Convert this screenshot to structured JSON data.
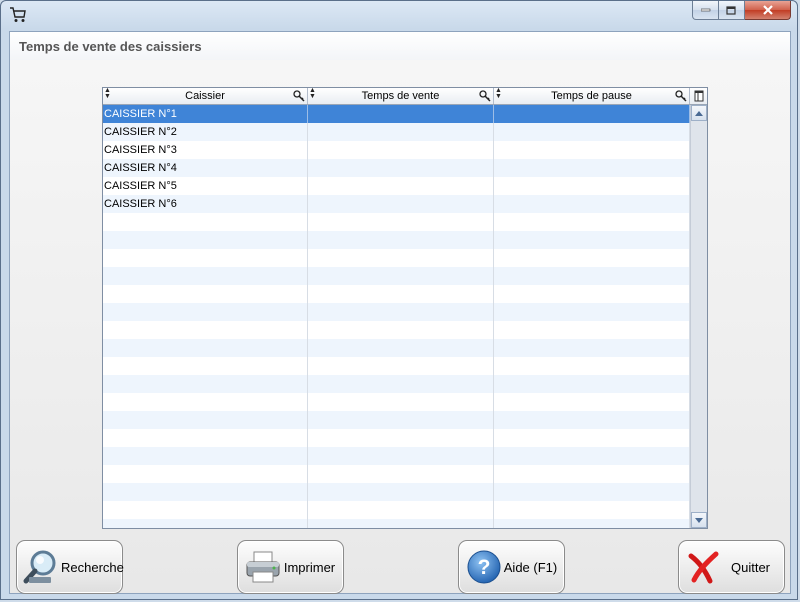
{
  "window": {
    "title": "",
    "app_icon": "cart-icon",
    "controls": {
      "minimize": "minimize-icon",
      "maximize": "maximize-icon",
      "close": "close-icon"
    }
  },
  "page": {
    "title": "Temps de vente des caissiers"
  },
  "table": {
    "columns": [
      {
        "label": "Caissier",
        "icon": "search-icon"
      },
      {
        "label": "Temps de vente",
        "icon": "search-icon"
      },
      {
        "label": "Temps de pause",
        "icon": "search-icon"
      }
    ],
    "rows": [
      [
        "CAISSIER N°1",
        "",
        ""
      ],
      [
        "CAISSIER N°2",
        "",
        ""
      ],
      [
        "CAISSIER N°3",
        "",
        ""
      ],
      [
        "CAISSIER N°4",
        "",
        ""
      ],
      [
        "CAISSIER N°5",
        "",
        ""
      ],
      [
        "CAISSIER N°6",
        "",
        ""
      ],
      [
        "",
        "",
        ""
      ],
      [
        "",
        "",
        ""
      ],
      [
        "",
        "",
        ""
      ],
      [
        "",
        "",
        ""
      ],
      [
        "",
        "",
        ""
      ],
      [
        "",
        "",
        ""
      ],
      [
        "",
        "",
        ""
      ],
      [
        "",
        "",
        ""
      ],
      [
        "",
        "",
        ""
      ],
      [
        "",
        "",
        ""
      ],
      [
        "",
        "",
        ""
      ],
      [
        "",
        "",
        ""
      ],
      [
        "",
        "",
        ""
      ],
      [
        "",
        "",
        ""
      ],
      [
        "",
        "",
        ""
      ],
      [
        "",
        "",
        ""
      ],
      [
        "",
        "",
        ""
      ],
      [
        "",
        "",
        ""
      ]
    ],
    "selected_row": 0,
    "selection_color": "#3f84d7"
  },
  "buttons": {
    "search": {
      "label": "Recherche",
      "icon": "magnifier-icon"
    },
    "print": {
      "label": "Imprimer",
      "icon": "printer-icon"
    },
    "help": {
      "label": "Aide (F1)",
      "icon": "help-icon"
    },
    "quit": {
      "label": "Quitter",
      "icon": "red-x-icon"
    }
  }
}
